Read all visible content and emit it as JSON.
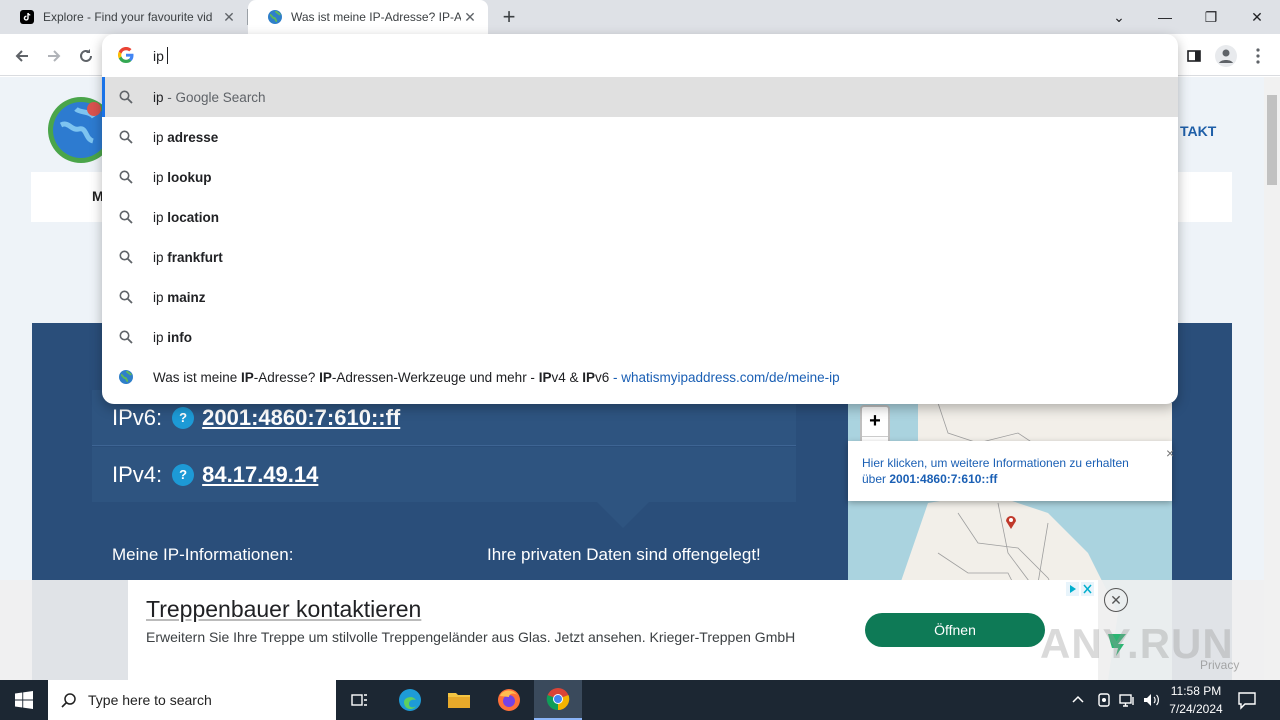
{
  "tabs": [
    {
      "title": "Explore - Find your favourite vid",
      "close": "✕"
    },
    {
      "title": "Was ist meine IP-Adresse? IP-Ad",
      "close": "✕"
    }
  ],
  "new_tab": "+",
  "window_controls": {
    "minimize": "—",
    "restore": "❐",
    "close": "✕",
    "dropdown": "⌄"
  },
  "omnibox": {
    "query": "ip",
    "suggestions": [
      {
        "prefix": "ip",
        "bold": "",
        "suffix": " - Google Search",
        "icon": "search-icon"
      },
      {
        "prefix": "ip ",
        "bold": "adresse",
        "suffix": "",
        "icon": "search-icon"
      },
      {
        "prefix": "ip ",
        "bold": "lookup",
        "suffix": "",
        "icon": "search-icon"
      },
      {
        "prefix": "ip ",
        "bold": "location",
        "suffix": "",
        "icon": "search-icon"
      },
      {
        "prefix": "ip ",
        "bold": "frankfurt",
        "suffix": "",
        "icon": "search-icon"
      },
      {
        "prefix": "ip ",
        "bold": "mainz",
        "suffix": "",
        "icon": "search-icon"
      },
      {
        "prefix": "ip ",
        "bold": "info",
        "suffix": "",
        "icon": "search-icon"
      }
    ],
    "history": {
      "t1": "Was ist meine ",
      "b1": "IP",
      "t2": "-Adresse? ",
      "b2": "IP",
      "t3": "-Adressen-Werkzeuge und mehr - ",
      "b3": "IP",
      "t4": "v4 & ",
      "b4": "IP",
      "t5": "v6",
      "sep": " - ",
      "url_a": "whatismyipaddress.com/de/meine-",
      "url_b": "ip"
    }
  },
  "page": {
    "nav_partial": "TAKT",
    "menu_partial": "M",
    "ipv6_label": "IPv6:",
    "ipv6_value": "2001:4860:7:610::ff",
    "ipv4_label": "IPv4:",
    "ipv4_value": "84.17.49.14",
    "help": "?",
    "my_info": "Meine IP-Informationen:",
    "exposed": "Ihre privaten Daten sind offengelegt!",
    "map_zoom_in": "+",
    "map_zoom_out": "−",
    "map_popup_text": "Hier klicken, um weitere Informationen zu erhalten über ",
    "map_popup_ip": "2001:4860:7:610::ff",
    "map_popup_close": "×"
  },
  "ad": {
    "title": "Treppenbauer kontaktieren",
    "body": "Erweitern Sie Ihre Treppe um stilvolle Treppengeländer aus Glas. Jetzt ansehen. Krieger-Treppen GmbH",
    "button": "Öffnen",
    "privacy": "Privacy"
  },
  "watermark": "ANY.RUN",
  "taskbar": {
    "search_placeholder": "Type here to search",
    "time": "11:58 PM",
    "date": "7/24/2024"
  },
  "colors": {
    "page_blue": "#2a4e7a",
    "ip_box": "#2e5480",
    "help_badge": "#1d9ad6",
    "ad_button": "#0e7a56",
    "url_blue": "#1a5fb4"
  }
}
